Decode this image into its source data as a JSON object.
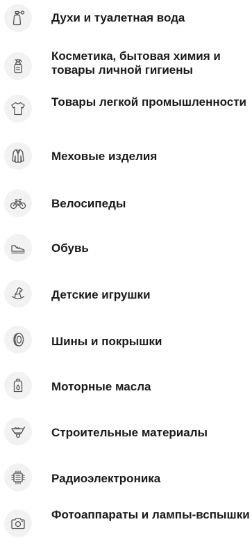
{
  "categories": [
    {
      "label": "Духи и туалетная вода",
      "icon": "perfume-icon"
    },
    {
      "label": "Косметика, бытовая химия и товары личной гигиены",
      "icon": "spray-bottle-icon"
    },
    {
      "label": "Товары легкой промышленности",
      "icon": "t-shirt-icon"
    },
    {
      "label": "Меховые изделия",
      "icon": "fur-coat-icon"
    },
    {
      "label": "Велосипеды",
      "icon": "bicycle-icon"
    },
    {
      "label": "Обувь",
      "icon": "shoe-icon"
    },
    {
      "label": "Детские игрушки",
      "icon": "rocking-horse-icon"
    },
    {
      "label": "Шины и покрышки",
      "icon": "tire-icon"
    },
    {
      "label": "Моторные масла",
      "icon": "oil-can-icon"
    },
    {
      "label": "Строительные материалы",
      "icon": "wheelbarrow-icon"
    },
    {
      "label": "Радиоэлектроника",
      "icon": "microchip-icon"
    },
    {
      "label": "Фотоаппараты и лампы-вспышки",
      "icon": "camera-icon"
    }
  ],
  "colors": {
    "icon_bg": "#f2f2f2",
    "icon_stroke": "#555555",
    "text": "#1a1a1a"
  }
}
